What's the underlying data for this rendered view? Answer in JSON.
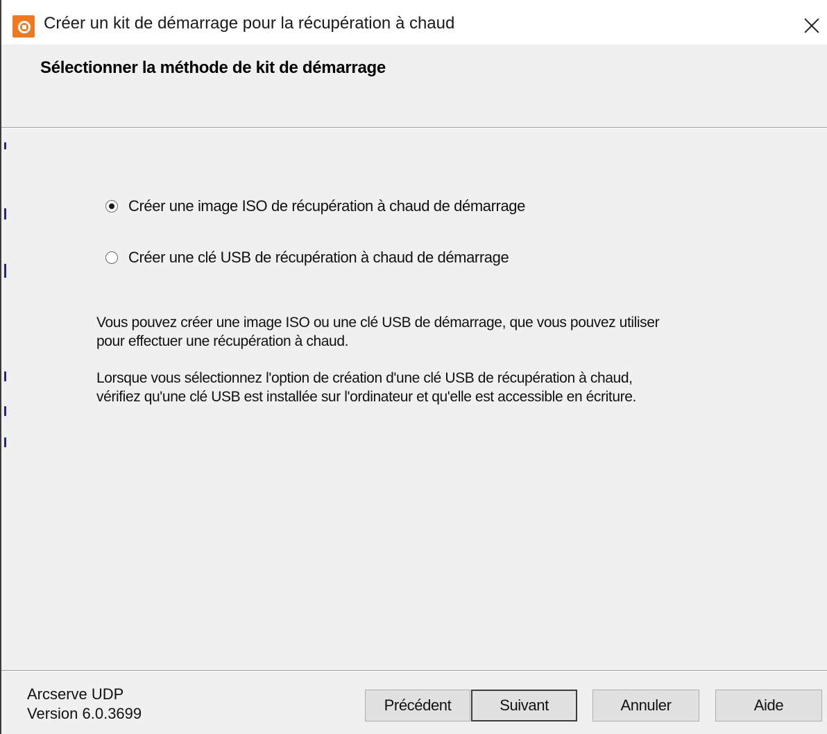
{
  "window": {
    "title": "Créer un kit de démarrage pour la récupération à chaud",
    "app_icon": "arcserve-app-icon",
    "close_icon": "close-icon"
  },
  "header": {
    "title": "Sélectionner la méthode de kit de démarrage"
  },
  "options": [
    {
      "label": "Créer une image ISO de récupération à chaud de démarrage",
      "selected": true
    },
    {
      "label": "Créer une clé USB de récupération à chaud de démarrage",
      "selected": false
    }
  ],
  "description": {
    "para1_line1": "Vous pouvez créer une image ISO ou une clé USB de démarrage, que vous pouvez utiliser",
    "para1_line2": "pour effectuer une récupération à chaud.",
    "para2_line1": "Lorsque vous sélectionnez l'option de création d'une clé USB de récupération à chaud,",
    "para2_line2": "vérifiez qu'une clé USB est installée sur l'ordinateur et qu'elle est accessible en écriture."
  },
  "footer": {
    "product_name": "Arcserve UDP",
    "version": "Version 6.0.3699",
    "buttons": {
      "previous": "Précédent",
      "next": "Suivant",
      "cancel": "Annuler",
      "help": "Aide"
    }
  }
}
